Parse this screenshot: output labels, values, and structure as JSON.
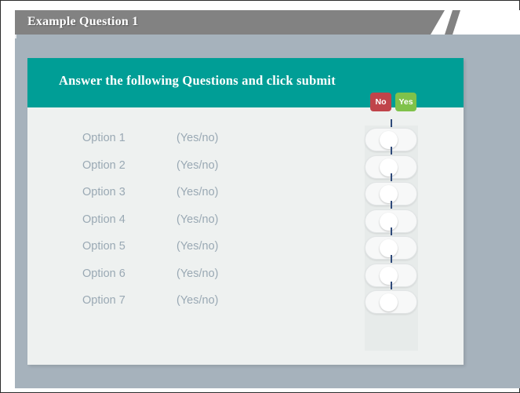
{
  "slide": {
    "title": "Example Question 1",
    "banner_text": "Answer the following Questions and click submit",
    "colors": {
      "background": "#a6b2bc",
      "title_bar": "#828282",
      "banner": "#009e96",
      "card": "#eef1f0",
      "label_text": "#9aa9b4",
      "badge_no": "#c0444a",
      "badge_yes": "#7fc24a",
      "divider": "#2f4a7a"
    }
  },
  "column_headers": {
    "no_label": "No",
    "yes_label": "Yes"
  },
  "options": [
    {
      "label": "Option 1",
      "hint": "(Yes/no)",
      "state": "unset"
    },
    {
      "label": "Option 2",
      "hint": "(Yes/no)",
      "state": "unset"
    },
    {
      "label": "Option 3",
      "hint": "(Yes/no)",
      "state": "unset"
    },
    {
      "label": "Option 4",
      "hint": "(Yes/no)",
      "state": "unset"
    },
    {
      "label": "Option 5",
      "hint": "(Yes/no)",
      "state": "unset"
    },
    {
      "label": "Option 6",
      "hint": "(Yes/no)",
      "state": "unset"
    },
    {
      "label": "Option 7",
      "hint": "(Yes/no)",
      "state": "unset"
    }
  ]
}
